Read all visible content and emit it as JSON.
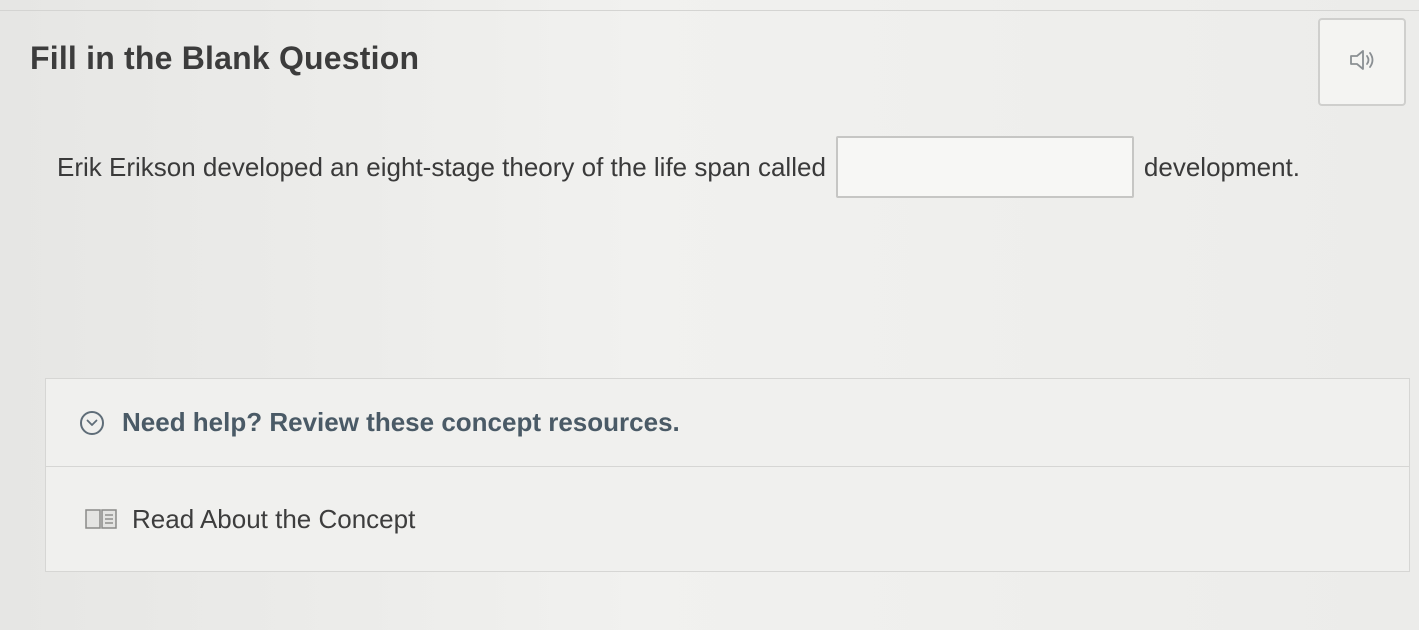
{
  "question": {
    "title": "Fill in the Blank Question",
    "text_before": "Erik Erikson developed an eight-stage theory of the life span called",
    "blank_value": "",
    "text_after": "development."
  },
  "help": {
    "header_label": "Need help? Review these concept resources.",
    "resources": [
      {
        "label": "Read About the Concept",
        "icon": "book-icon"
      }
    ]
  },
  "icons": {
    "audio": "speaker-icon",
    "expand": "chevron-down-icon"
  },
  "colors": {
    "help_text": "#4a5a66",
    "border": "#c6c6c4"
  }
}
